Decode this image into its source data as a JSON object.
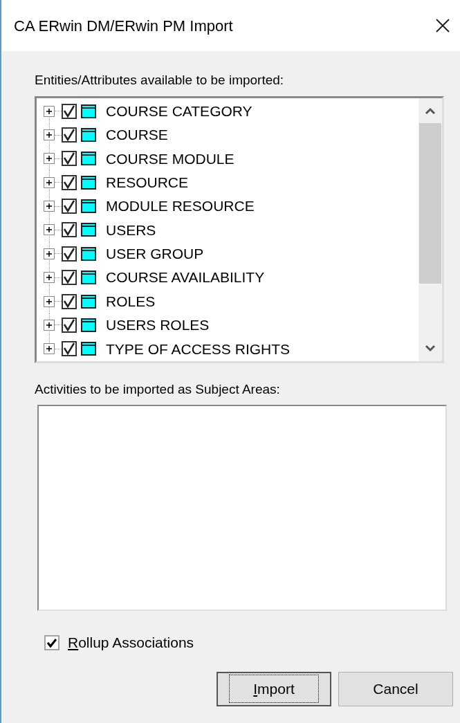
{
  "window": {
    "title": "CA ERwin DM/ERwin PM Import"
  },
  "entities": {
    "label": "Entities/Attributes available to be imported:",
    "items": [
      {
        "name": "COURSE CATEGORY",
        "checked": true
      },
      {
        "name": "COURSE",
        "checked": true
      },
      {
        "name": "COURSE MODULE",
        "checked": true
      },
      {
        "name": "RESOURCE",
        "checked": true
      },
      {
        "name": "MODULE RESOURCE",
        "checked": true
      },
      {
        "name": "USERS",
        "checked": true
      },
      {
        "name": "USER GROUP",
        "checked": true
      },
      {
        "name": "COURSE AVAILABILITY",
        "checked": true
      },
      {
        "name": "ROLES",
        "checked": true
      },
      {
        "name": "USERS ROLES",
        "checked": true
      },
      {
        "name": "TYPE OF ACCESS RIGHTS",
        "checked": true
      }
    ]
  },
  "activities": {
    "label": "Activities to be imported as Subject Areas:"
  },
  "rollup": {
    "label": "Rollup Associations",
    "checked": true
  },
  "buttons": [
    {
      "label": "Import",
      "default": true
    },
    {
      "label": "Cancel",
      "default": false
    }
  ]
}
